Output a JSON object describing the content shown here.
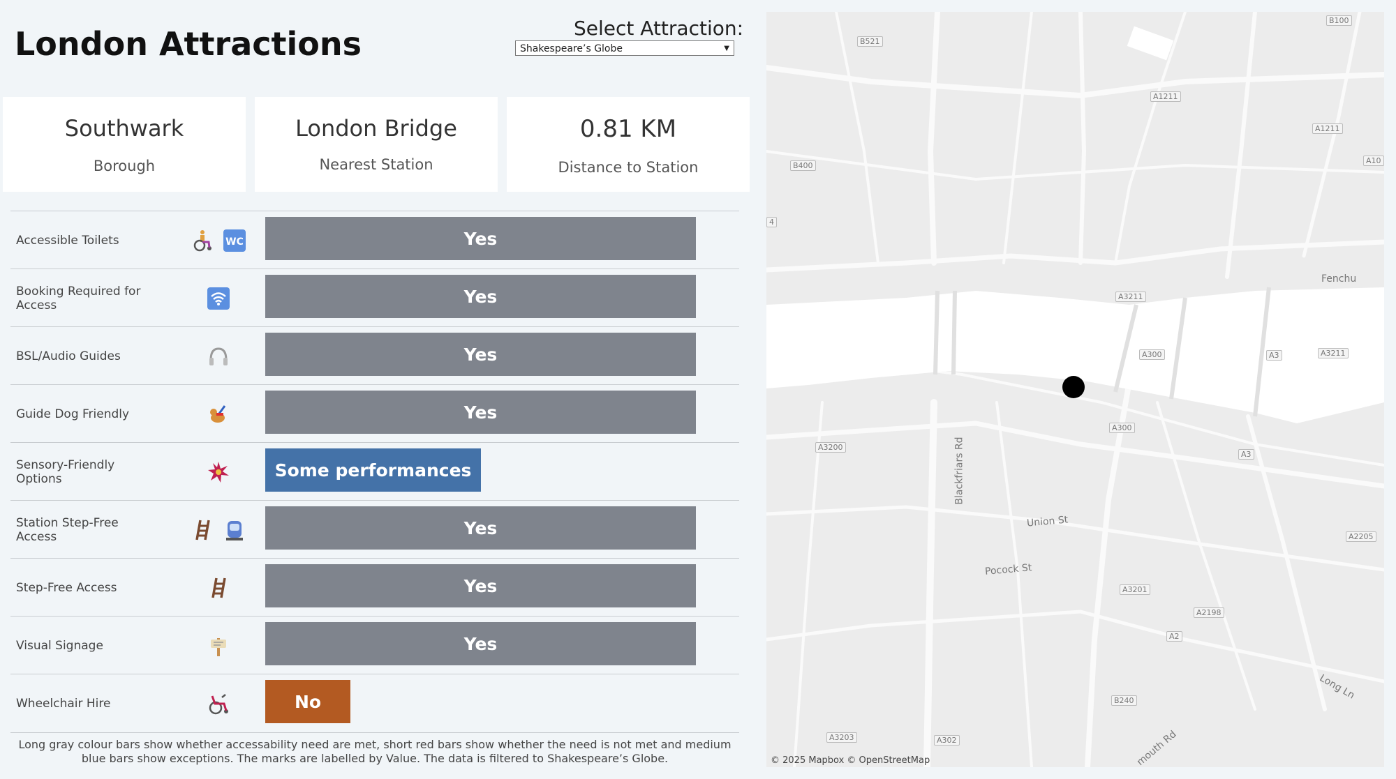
{
  "header": {
    "title": "London Attractions",
    "select_label": "Select Attraction:",
    "select_value": "Shakespeare’s Globe"
  },
  "cards": [
    {
      "value": "Southwark",
      "label": "Borough"
    },
    {
      "value": "London Bridge",
      "label": "Nearest Station"
    },
    {
      "value": "0.81 KM",
      "label": "Distance to Station"
    }
  ],
  "colors": {
    "yes": "#7f848d",
    "exception": "#4472a8",
    "no": "#b35a22"
  },
  "rows": [
    {
      "label": "Accessible Toilets",
      "icons": [
        "wheelchair-icon",
        "wc-icon"
      ],
      "value": "Yes",
      "status": "met"
    },
    {
      "label": "Booking Required for Access",
      "icons": [
        "wifi-icon"
      ],
      "value": "Yes",
      "status": "met"
    },
    {
      "label": "BSL/Audio Guides",
      "icons": [
        "headphones-icon"
      ],
      "value": "Yes",
      "status": "met"
    },
    {
      "label": "Guide Dog Friendly",
      "icons": [
        "guide-dog-icon"
      ],
      "value": "Yes",
      "status": "met"
    },
    {
      "label": "Sensory-Friendly Options",
      "icons": [
        "sparkle-icon"
      ],
      "value": "Some performances",
      "status": "exception"
    },
    {
      "label": "Station Step-Free Access",
      "icons": [
        "ladder-icon",
        "tram-icon"
      ],
      "value": "Yes",
      "status": "met"
    },
    {
      "label": "Step-Free Access",
      "icons": [
        "ladder-icon"
      ],
      "value": "Yes",
      "status": "met"
    },
    {
      "label": "Visual Signage",
      "icons": [
        "signpost-icon"
      ],
      "value": "Yes",
      "status": "met"
    },
    {
      "label": "Wheelchair Hire",
      "icons": [
        "manual-wheelchair-icon"
      ],
      "value": "No",
      "status": "not-met"
    }
  ],
  "footnote": "Long gray colour bars show whether accessability need are met, short red bars show whether the need is not met and medium blue bars show exceptions. The marks are labelled by Value. The data is filtered to Shakespeare’s Globe.",
  "map": {
    "attribution": "© 2025 Mapbox  © OpenStreetMap",
    "road_labels": [
      "B100",
      "B521",
      "A1211",
      "A1211",
      "B400",
      "A10",
      "A3211",
      "Fenchu",
      "A300",
      "A3",
      "A3211",
      "A3200",
      "Blackfriars Rd",
      "A300",
      "A3",
      "Union St",
      "A2205",
      "Pocock St",
      "A3201",
      "A2198",
      "A2",
      "B240",
      "Long Ln",
      "A3203",
      "A302",
      "mouth Rd",
      "4"
    ]
  }
}
